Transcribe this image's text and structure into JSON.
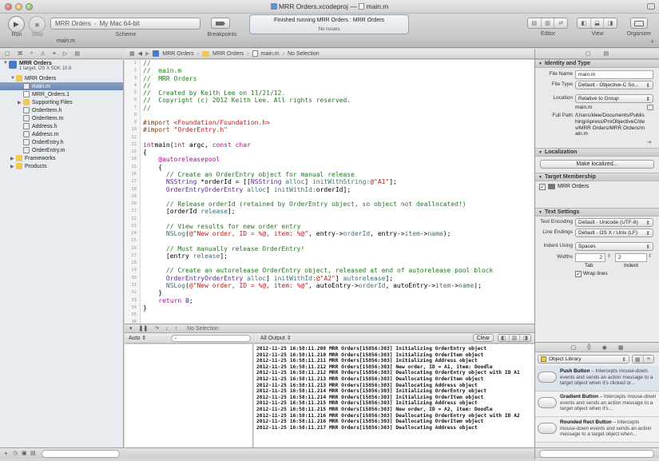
{
  "window": {
    "title": "MRR Orders.xcodeproj",
    "title_separator": "—",
    "file_title": "main.m"
  },
  "toolbar": {
    "run_label": "Run",
    "stop_label": "Stop",
    "scheme_label": "Scheme",
    "scheme_target": "MRR Orders",
    "scheme_destination": "My Mac 64-bit",
    "breakpoints_label": "Breakpoints",
    "editor_label": "Editor",
    "view_label": "View",
    "organizer_label": "Organizer",
    "activity_status": "Finished running MRR Orders : MRR Orders",
    "activity_issues": "No Issues"
  },
  "tab": {
    "label": "main.m"
  },
  "navigator": {
    "project_name": "MRR Orders",
    "project_subtitle": "1 target, OS X SDK 10.8",
    "items": [
      {
        "label": "MRR Orders",
        "indent": 1,
        "kind": "folder",
        "open": true
      },
      {
        "label": "main.m",
        "indent": 2,
        "kind": "m",
        "selected": true
      },
      {
        "label": "MRR_Orders.1",
        "indent": 2,
        "kind": "doc"
      },
      {
        "label": "Supporting Files",
        "indent": 2,
        "kind": "folder",
        "open": false
      },
      {
        "label": "OrderItem.h",
        "indent": 2,
        "kind": "h"
      },
      {
        "label": "OrderItem.m",
        "indent": 2,
        "kind": "m"
      },
      {
        "label": "Address.h",
        "indent": 2,
        "kind": "h"
      },
      {
        "label": "Address.m",
        "indent": 2,
        "kind": "m"
      },
      {
        "label": "OrderEntry.h",
        "indent": 2,
        "kind": "h"
      },
      {
        "label": "OrderEntry.m",
        "indent": 2,
        "kind": "m"
      },
      {
        "label": "Frameworks",
        "indent": 1,
        "kind": "folder",
        "open": false
      },
      {
        "label": "Products",
        "indent": 1,
        "kind": "folder",
        "open": false
      }
    ]
  },
  "jumpbar": {
    "crumbs": [
      "MRR Orders",
      "MRR Orders",
      "main.m",
      "No Selection"
    ]
  },
  "editor": {
    "line_numbers": [
      "1",
      "2",
      "3",
      "4",
      "5",
      "6",
      "7",
      "8",
      "9",
      "10",
      "11",
      "12",
      "13",
      "14",
      "15",
      "16",
      "17",
      "18",
      "19",
      "20",
      "21",
      "22",
      "23",
      "24",
      "25",
      "26",
      "27",
      "28",
      "29",
      "30",
      "31",
      "32",
      "33",
      "34",
      "35",
      "36"
    ],
    "lines": [
      [
        [
          "c-com",
          "//"
        ]
      ],
      [
        [
          "c-com",
          "//  main.m"
        ]
      ],
      [
        [
          "c-com",
          "//  MRR Orders"
        ]
      ],
      [
        [
          "c-com",
          "//"
        ]
      ],
      [
        [
          "c-com",
          "//  Created by Keith Lee on 11/21/12."
        ]
      ],
      [
        [
          "c-com",
          "//  Copyright (c) 2012 Keith Lee. All rights reserved."
        ]
      ],
      [
        [
          "c-com",
          "//"
        ]
      ],
      [],
      [
        [
          "c-pre",
          "#import "
        ],
        [
          "c-str",
          "<Foundation/Foundation.h>"
        ]
      ],
      [
        [
          "c-pre",
          "#import "
        ],
        [
          "c-str",
          "\"OrderEntry.h\""
        ]
      ],
      [],
      [
        [
          "c-kw",
          "int"
        ],
        [
          "",
          "main("
        ],
        [
          "c-kw",
          "int"
        ],
        [
          "",
          " argc, "
        ],
        [
          "c-kw",
          "const char"
        ],
        [
          "",
          "",
          " * argv[])"
        ]
      ],
      [
        [
          "",
          "{"
        ]
      ],
      [
        [
          "",
          "    "
        ],
        [
          "c-kw",
          "@autoreleasepool"
        ]
      ],
      [
        [
          "",
          "    {"
        ]
      ],
      [
        [
          "c-com",
          "      // Create an OrderEntry object for manual release"
        ]
      ],
      [
        [
          "",
          "      "
        ],
        [
          "c-type",
          "NSString"
        ],
        [
          "",
          " *orderId = [["
        ],
        [
          "c-type",
          "NSString"
        ],
        [
          "c-fn",
          " alloc"
        ],
        [
          "",
          "] "
        ],
        [
          "c-fn",
          "initWithString:"
        ],
        [
          "c-str",
          "@\"A1\""
        ],
        [
          "",
          "];"
        ]
      ],
      [
        [
          "",
          "      "
        ],
        [
          "c-type",
          "OrderEntry"
        ],
        [
          "",
          "",
          " *entry = [["
        ],
        [
          "c-type",
          "OrderEntry"
        ],
        [
          "c-fn",
          " alloc"
        ],
        [
          "",
          "] "
        ],
        [
          "c-fn",
          "initWithId:"
        ],
        [
          "",
          "orderId];"
        ]
      ],
      [],
      [
        [
          "c-com",
          "      // Release orderId (retained by OrderEntry object, so object not deallocated!)"
        ]
      ],
      [
        [
          "",
          "      [orderId "
        ],
        [
          "c-fn",
          "release"
        ],
        [
          "",
          "];"
        ]
      ],
      [],
      [
        [
          "c-com",
          "      // View results for new order entry"
        ]
      ],
      [
        [
          "",
          "      "
        ],
        [
          "c-fn",
          "NSLog"
        ],
        [
          "",
          "("
        ],
        [
          "c-str",
          "@\"New order, ID = %@, item: %@\""
        ],
        [
          "",
          ", entry->"
        ],
        [
          "c-fn",
          "orderId"
        ],
        [
          "",
          ", entry->"
        ],
        [
          "c-fn",
          "item"
        ],
        [
          "",
          "->"
        ],
        [
          "c-fn",
          "name"
        ],
        [
          "",
          ");"
        ]
      ],
      [],
      [
        [
          "c-com",
          "      // Must manually release OrderEntry!"
        ]
      ],
      [
        [
          "",
          "      [entry "
        ],
        [
          "c-fn",
          "release"
        ],
        [
          "",
          "];"
        ]
      ],
      [],
      [
        [
          "c-com",
          "      // Create an autorelease OrderEntry object, released at end of autorelease pool block"
        ]
      ],
      [
        [
          "",
          "      "
        ],
        [
          "c-type",
          "OrderEntry"
        ],
        [
          "",
          "",
          " *autoEntry = [[["
        ],
        [
          "c-type",
          "OrderEntry"
        ],
        [
          "c-fn",
          " alloc"
        ],
        [
          "",
          "] "
        ],
        [
          "c-fn",
          "initWithId:"
        ],
        [
          "c-str",
          "@\"A2\""
        ],
        [
          "",
          "] "
        ],
        [
          "c-fn",
          "autorelease"
        ],
        [
          "",
          "];"
        ]
      ],
      [
        [
          "",
          "      "
        ],
        [
          "c-fn",
          "NSLog"
        ],
        [
          "",
          "("
        ],
        [
          "c-str",
          "@\"New order, ID = %@, item: %@\""
        ],
        [
          "",
          ", autoEntry->"
        ],
        [
          "c-fn",
          "orderId"
        ],
        [
          "",
          ", autoEntry->"
        ],
        [
          "c-fn",
          "item"
        ],
        [
          "",
          "->"
        ],
        [
          "c-fn",
          "name"
        ],
        [
          "",
          ");"
        ]
      ],
      [
        [
          "",
          "    }"
        ]
      ],
      [
        [
          "",
          "    "
        ],
        [
          "c-kw",
          "return"
        ],
        [
          "",
          " "
        ],
        [
          "c-num",
          "0"
        ],
        [
          "",
          ";"
        ]
      ],
      [
        [
          "",
          "}"
        ]
      ],
      [],
      []
    ]
  },
  "debug": {
    "selection_label": "No Selection",
    "vars_scope": "Auto",
    "console_filter": "All Output",
    "clear_label": "Clear"
  },
  "console": {
    "lines": [
      "2012-11-25 16:58:11.208 MRR Orders[15856:303] Initializing OrderEntry object",
      "2012-11-25 16:58:11.210 MRR Orders[15856:303] Initializing OrderItem object",
      "2012-11-25 16:58:11.211 MRR Orders[15856:303] Initializing Address object",
      "2012-11-25 16:58:11.212 MRR Orders[15856:303] New order, ID = A1, item: Doodle",
      "2012-11-25 16:58:11.212 MRR Orders[15856:303] Deallocating OrderEntry object with ID A1",
      "2012-11-25 16:58:11.213 MRR Orders[15856:303] Deallocating OrderItem object",
      "2012-11-25 16:58:11.213 MRR Orders[15856:303] Deallocating Address object",
      "2012-11-25 16:58:11.214 MRR Orders[15856:303] Initializing OrderEntry object",
      "2012-11-25 16:58:11.214 MRR Orders[15856:303] Initializing OrderItem object",
      "2012-11-25 16:58:11.215 MRR Orders[15856:303] Initializing Address object",
      "2012-11-25 16:58:11.215 MRR Orders[15856:303] New order, ID = A2, item: Doodle",
      "2012-11-25 16:58:11.216 MRR Orders[15856:303] Deallocating OrderEntry object with ID A2",
      "2012-11-25 16:58:11.216 MRR Orders[15856:303] Deallocating OrderItem object",
      "2012-11-25 16:58:11.217 MRR Orders[15856:303] Deallocating Address object"
    ]
  },
  "inspector": {
    "identity_title": "Identity and Type",
    "file_name_label": "File Name",
    "file_name_value": "main.m",
    "file_type_label": "File Type",
    "file_type_value": "Default - Objective-C So...",
    "location_label": "Location",
    "location_value": "Relative to Group",
    "location_file": "main.m",
    "full_path_label": "Full Path",
    "full_path_value": "/Users/klee/Documents/Publishing/Apress/ProObjectiveC/dev/MRR Orders/MRR Orders/main.m",
    "localization_title": "Localization",
    "make_localized_label": "Make localized...",
    "target_membership_title": "Target Membership",
    "target_name": "MRR Orders",
    "text_settings_title": "Text Settings",
    "text_encoding_label": "Text Encoding",
    "text_encoding_value": "Default - Unicode (UTF-8)",
    "line_endings_label": "Line Endings",
    "line_endings_value": "Default - OS X / Unix (LF)",
    "indent_using_label": "Indent Using",
    "indent_using_value": "Spaces",
    "widths_label": "Widths",
    "tab_width": "2",
    "indent_width": "2",
    "tab_label": "Tab",
    "indent_label": "Indent",
    "wrap_lines_label": "Wrap lines"
  },
  "library": {
    "selector_label": "Object Library",
    "items": [
      {
        "name": "Push Button",
        "desc": " – Intercepts mouse-down events and sends an action message to a target object when it's clicked or..."
      },
      {
        "name": "Gradient Button",
        "desc": " – Intercepts mouse-down events and sends an action message to a target object when it's..."
      },
      {
        "name": "Rounded Rect Button",
        "desc": " – Intercepts mouse-down events and sends an action message to a target object when..."
      }
    ]
  }
}
